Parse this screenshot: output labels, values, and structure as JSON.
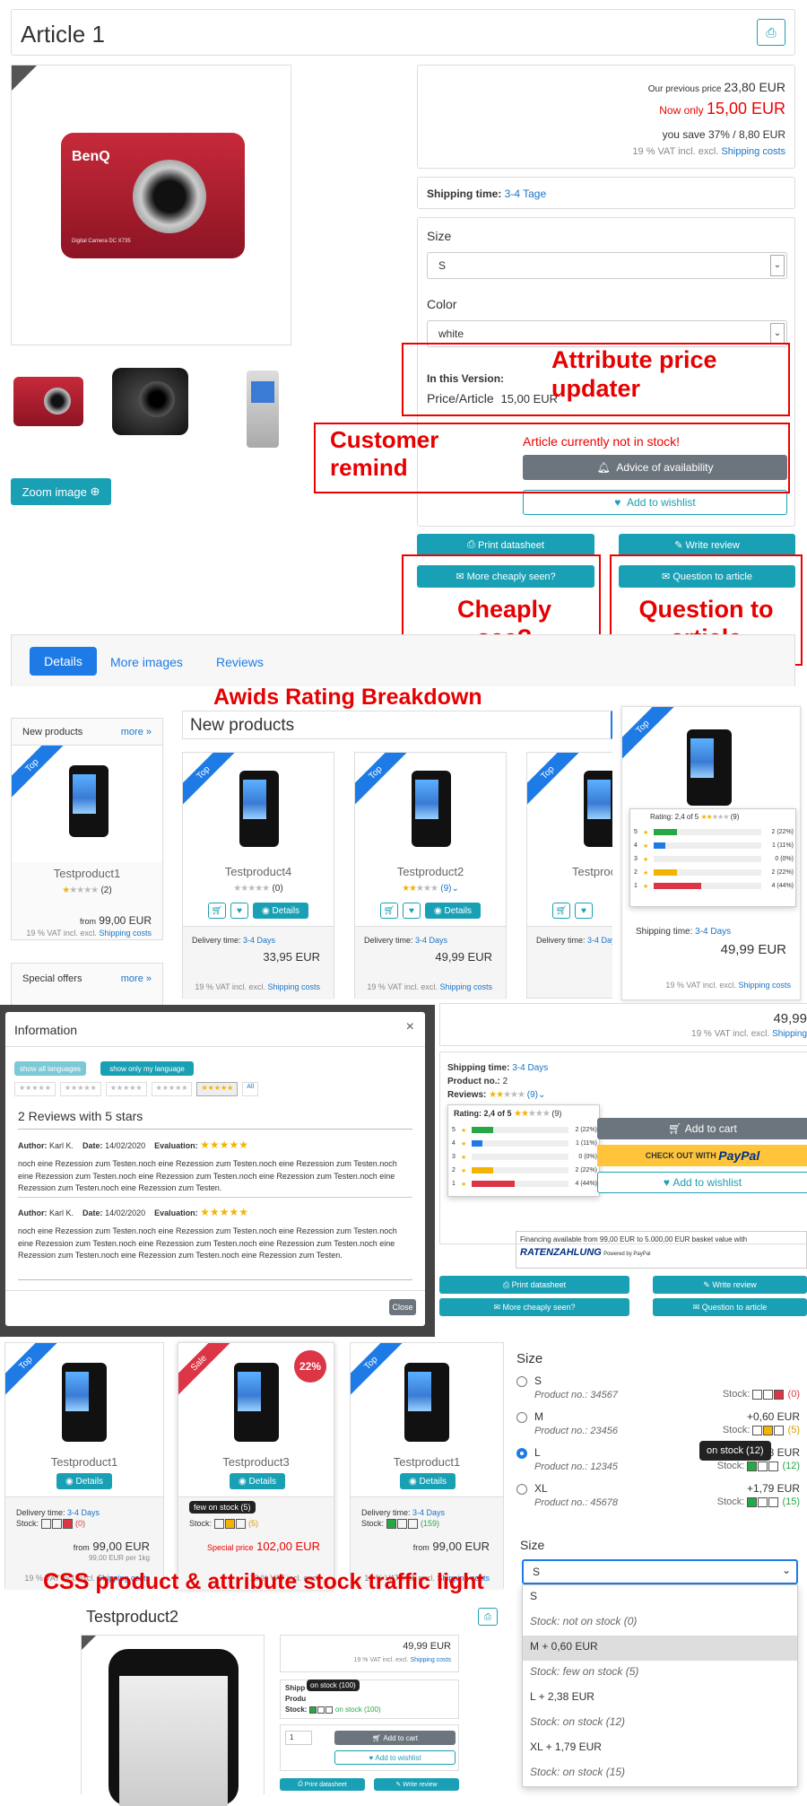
{
  "article": {
    "title": "Article 1",
    "prev_price_label": "Our previous price",
    "prev_price": "23,80 EUR",
    "now_label": "Now only",
    "now_price": "15,00 EUR",
    "save": "you save 37% / 8,80 EUR",
    "vat": "19 % VAT incl. excl.",
    "shipping_costs": "Shipping costs",
    "shipping_time_label": "Shipping time:",
    "shipping_time_value": "3-4 Tage",
    "size_label": "Size",
    "size_value": "S",
    "color_label": "Color",
    "color_value": "white",
    "in_version": "In this Version:",
    "price_article": "Price/Article",
    "price_article_value": "15,00 EUR",
    "not_in_stock": "Article currently not in stock!",
    "advice": "Advice of availability",
    "add_wishlist": "Add to wishlist",
    "print_datasheet": "Print datasheet",
    "write_review": "Write review",
    "more_cheaply": "More cheaply seen?",
    "question": "Question to article",
    "zoom": "Zoom image",
    "camera_text": "BenQ",
    "camera_model": "Digital Camera DC X735"
  },
  "annotations": {
    "attr_price": "Attribute price updater",
    "customer_remind": "Customer remind",
    "cheaply": "Cheaply see?",
    "question": "Question to article",
    "awids": "Awids Rating Breakdown",
    "css_stock": "CSS product & attribute stock traffic light"
  },
  "tabs": [
    "Details",
    "More images",
    "Reviews"
  ],
  "sidebar": {
    "new_products": "New products",
    "more": "more »",
    "special_offers": "Special offers",
    "product_name": "Testproduct1",
    "rating_count": "(2)",
    "from": "from",
    "price": "99,00 EUR",
    "vat": "19 % VAT incl. excl.",
    "shipping": "Shipping costs"
  },
  "new_products_title": "New products",
  "products": [
    {
      "name": "Testproduct4",
      "count": "(0)",
      "price": "33,95 EUR"
    },
    {
      "name": "Testproduct2",
      "count": "(9)",
      "price": "49,99 EUR"
    },
    {
      "name": "Testproc",
      "count": "",
      "price": ""
    }
  ],
  "product_common": {
    "details": "Details",
    "delivery_label": "Delivery time:",
    "delivery_value": "3-4 Days",
    "vat": "19 % VAT incl. excl.",
    "shipping": "Shipping costs",
    "top": "Top",
    "sale": "Sale"
  },
  "rating_popup": {
    "title": "Rating: 2,4 of 5",
    "count": "(9)",
    "rows": [
      {
        "star": "5",
        "pct": "2 (22%)",
        "fill": 22,
        "color": "#28a745"
      },
      {
        "star": "4",
        "pct": "1 (11%)",
        "fill": 11,
        "color": "#1e7be6"
      },
      {
        "star": "3",
        "pct": "0 (0%)",
        "fill": 0,
        "color": "#f5b301"
      },
      {
        "star": "2",
        "pct": "2 (22%)",
        "fill": 22,
        "color": "#f5b301"
      },
      {
        "star": "1",
        "pct": "4 (44%)",
        "fill": 44,
        "color": "#dc3545"
      }
    ],
    "shipping_label": "Shipping time:",
    "shipping_value": "3-4 Days",
    "price": "49,99 EUR"
  },
  "modal": {
    "title": "Information",
    "close_x": "×",
    "btn_all": "show all languages",
    "btn_my": "show only my language",
    "all": "All",
    "heading": "2 Reviews with 5 stars",
    "author_label": "Author:",
    "author": "Karl K.",
    "date_label": "Date:",
    "date": "14/02/2020",
    "eval_label": "Evaluation:",
    "text1": "noch eine Rezession zum Testen.noch eine Rezession zum Testen.noch eine Rezession zum Testen.noch eine Rezession zum Testen.noch eine Rezession zum Testen.noch eine Rezession zum Testen.noch eine Rezession zum Testen.noch eine Rezession zum Testen.",
    "text2": "noch eine Rezession zum Testen.noch eine Rezession zum Testen.noch eine Rezession zum Testen.noch eine Rezession zum Testen.noch eine Rezession zum Testen.noch eine Rezession zum Testen.noch eine Rezession zum Testen.noch eine Rezession zum Testen.noch eine Rezession zum Testen.",
    "close": "Close"
  },
  "right_mid": {
    "price": "49,99",
    "vat": "19 % VAT incl. excl.",
    "shipping": "Shipping",
    "shipping_label": "Shipping time:",
    "shipping_value": "3-4 Days",
    "product_no_label": "Product no.:",
    "product_no": "2",
    "reviews_label": "Reviews:",
    "reviews_count": "(9)",
    "add_cart": "Add to cart",
    "checkout": "CHECK OUT WITH",
    "paypal": "PayPal",
    "wishlist": "Add to wishlist",
    "financing": "Financing available from 99,00 EUR to 5.000,00 EUR basket value with",
    "ratenzahlung": "RATENZAHLUNG",
    "powered": "Powered by PayPal",
    "print": "Print datasheet",
    "write": "Write review",
    "cheaply": "More cheaply seen?",
    "question": "Question to article"
  },
  "stock_products": [
    {
      "name": "Testproduct1",
      "tl_count": "(0)",
      "from": "from",
      "price": "99,00 EUR",
      "per": "99,00 EUR per 1kg"
    },
    {
      "name": "Testproduct3",
      "tl_count": "(5)",
      "sale_pct": "22%",
      "special": "Special price",
      "price": "102,00 EUR",
      "tooltip": "few on stock (5)"
    },
    {
      "name": "Testproduct1",
      "tl_count": "(159)",
      "from": "from",
      "price": "99,00 EUR"
    }
  ],
  "size_list": {
    "label": "Size",
    "stock": "Stock:",
    "product_no": "Product no.:",
    "tooltip": "on stock (12)",
    "items": [
      {
        "name": "S",
        "extra": "",
        "no": "34567",
        "count": "(0)",
        "count_color": "#dc3545"
      },
      {
        "name": "M",
        "extra": "+0,60 EUR",
        "no": "23456",
        "count": "(5)",
        "count_color": "#d4a000"
      },
      {
        "name": "L",
        "extra": "+2,38 EUR",
        "no": "12345",
        "count": "(12)",
        "count_color": "#28a745"
      },
      {
        "name": "XL",
        "extra": "+1,79 EUR",
        "no": "45678",
        "count": "(15)",
        "count_color": "#28a745"
      }
    ]
  },
  "size_dropdown": {
    "label": "Size",
    "value": "S",
    "options": [
      {
        "title": "S",
        "stock": "Stock: not on stock (0)"
      },
      {
        "title": "M + 0,60 EUR",
        "stock": "Stock: few on stock (5)"
      },
      {
        "title": "L + 2,38 EUR",
        "stock": "Stock: on stock (12)"
      },
      {
        "title": "XL + 1,79 EUR",
        "stock": "Stock: on stock (15)"
      }
    ]
  },
  "tp2": {
    "title": "Testproduct2",
    "price": "49,99 EUR",
    "vat": "19 % VAT incl. excl.",
    "shipping": "Shipping costs",
    "shipp": "Shipp",
    "produ": "Produ",
    "stock": "Stock:",
    "stock_value": "on stock (100)",
    "tooltip": "on stock (100)",
    "qty": "1",
    "add_cart": "Add to cart",
    "wishlist": "Add to wishlist",
    "print": "Print datasheet",
    "write": "Write review"
  },
  "colors": {
    "teal": "#1aa0b5",
    "red": "#e00000",
    "blue": "#1e7be6"
  }
}
